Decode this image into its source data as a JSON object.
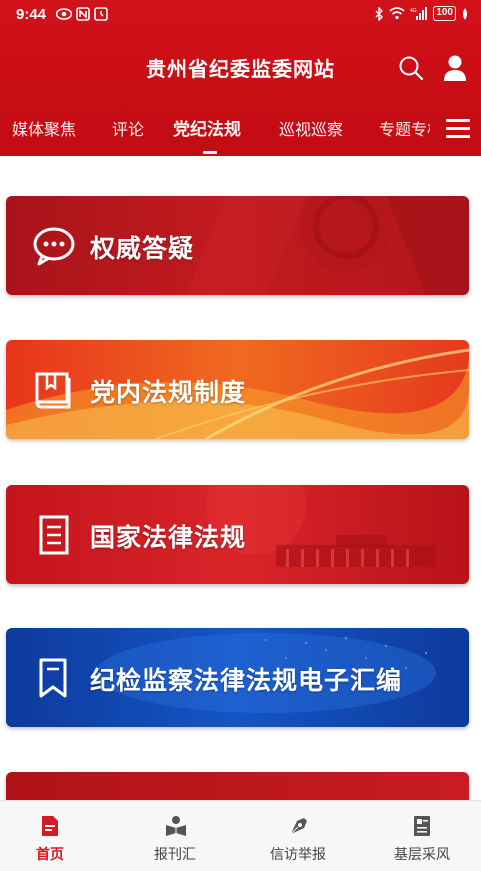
{
  "status_bar": {
    "time": "9:44",
    "battery": "100"
  },
  "header": {
    "title": "贵州省纪委监委网站"
  },
  "nav": {
    "tabs": [
      {
        "label": "媒体聚焦"
      },
      {
        "label": "评论"
      },
      {
        "label": "党纪法规",
        "active": true
      },
      {
        "label": "巡视巡察"
      },
      {
        "label": "专题专栏"
      }
    ]
  },
  "cards": [
    {
      "title": "权威答疑",
      "icon": "chat-bubble-icon"
    },
    {
      "title": "党内法规制度",
      "icon": "book-icon"
    },
    {
      "title": "国家法律法规",
      "icon": "document-icon"
    },
    {
      "title": "纪检监察法律法规电子汇编",
      "icon": "bookmark-icon"
    }
  ],
  "bottom_nav": [
    {
      "label": "首页",
      "icon": "document-home-icon",
      "active": true
    },
    {
      "label": "报刊汇",
      "icon": "reader-icon"
    },
    {
      "label": "信访举报",
      "icon": "pen-nib-icon"
    },
    {
      "label": "基层采风",
      "icon": "news-icon"
    }
  ],
  "colors": {
    "brand_red": "#c80d15",
    "active_tab": "#d61a22",
    "card_blue": "#1655c6"
  }
}
